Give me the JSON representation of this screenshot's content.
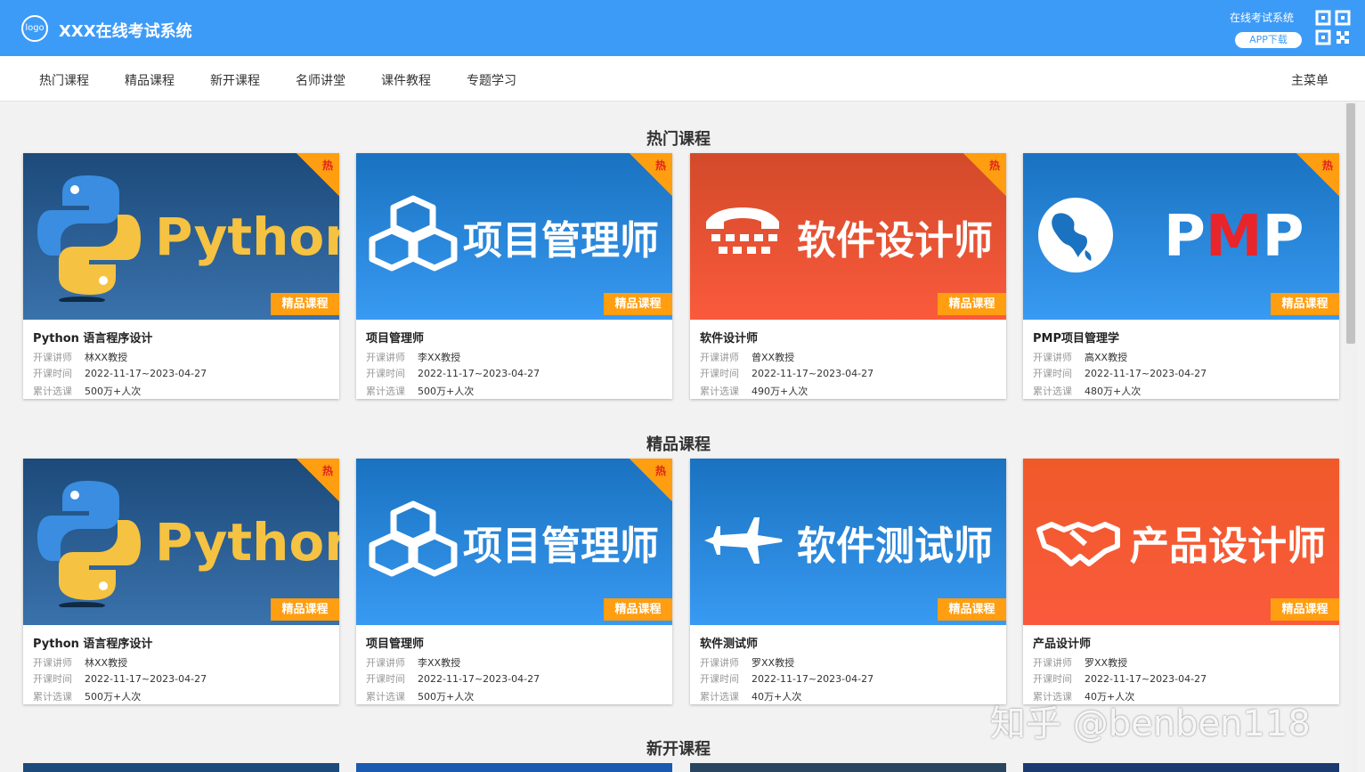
{
  "header": {
    "logo_text": "logo",
    "title": "XXX在线考试系统",
    "exam_link": "在线考试系统",
    "app_download": "APP下载"
  },
  "nav": {
    "items": [
      "热门课程",
      "精品课程",
      "新开课程",
      "名师讲堂",
      "课件教程",
      "专题学习"
    ],
    "main_menu": "主菜单"
  },
  "labels": {
    "hot": "热",
    "badge": "精品课程",
    "teacher": "开课讲师",
    "time": "开课时间",
    "count": "累计选课"
  },
  "sections": [
    {
      "title": "热门课程",
      "cards": [
        {
          "thumb_title": "Python",
          "name": "Python 语言程序设计",
          "teacher": "林XX教授",
          "time": "2022-11-17~2023-04-27",
          "count": "500万+人次",
          "icon": "python-logo-icon",
          "theme": "#1c4a7a"
        },
        {
          "thumb_title": "项目管理师",
          "name": "项目管理师",
          "teacher": "李XX教授",
          "time": "2022-11-17~2023-04-27",
          "count": "500万+人次",
          "icon": "cubes-icon",
          "theme": "#1a72c0"
        },
        {
          "thumb_title": "软件设计师",
          "name": "软件设计师",
          "teacher": "曾XX教授",
          "time": "2022-11-17~2023-04-27",
          "count": "490万+人次",
          "icon": "telephone-icon",
          "theme": "#d24a2a"
        },
        {
          "thumb_title": "PMP",
          "name": "PMP项目管理学",
          "teacher": "高XX教授",
          "time": "2022-11-17~2023-04-27",
          "count": "480万+人次",
          "icon": "globe-icon",
          "theme": "#1a72c0"
        }
      ]
    },
    {
      "title": "精品课程",
      "cards": [
        {
          "thumb_title": "Python",
          "name": "Python 语言程序设计",
          "teacher": "林XX教授",
          "time": "2022-11-17~2023-04-27",
          "count": "500万+人次",
          "icon": "python-logo-icon",
          "theme": "#1c4a7a"
        },
        {
          "thumb_title": "项目管理师",
          "name": "项目管理师",
          "teacher": "李XX教授",
          "time": "2022-11-17~2023-04-27",
          "count": "500万+人次",
          "icon": "cubes-icon",
          "theme": "#1a72c0"
        },
        {
          "thumb_title": "软件测试师",
          "name": "软件测试师",
          "teacher": "罗XX教授",
          "time": "2022-11-17~2023-04-27",
          "count": "40万+人次",
          "icon": "airplane-icon",
          "theme": "#1a72c0"
        },
        {
          "thumb_title": "产品设计师",
          "name": "产品设计师",
          "teacher": "罗XX教授",
          "time": "2022-11-17~2023-04-27",
          "count": "40万+人次",
          "icon": "handshake-icon",
          "theme": "#f05a2a"
        }
      ]
    },
    {
      "title": "新开课程",
      "cards": []
    }
  ],
  "watermark": "知乎 @benben118",
  "colors": {
    "primary": "#3d9bf8",
    "accent_orange": "#ff9e10",
    "hot_red": "#e0231b"
  }
}
